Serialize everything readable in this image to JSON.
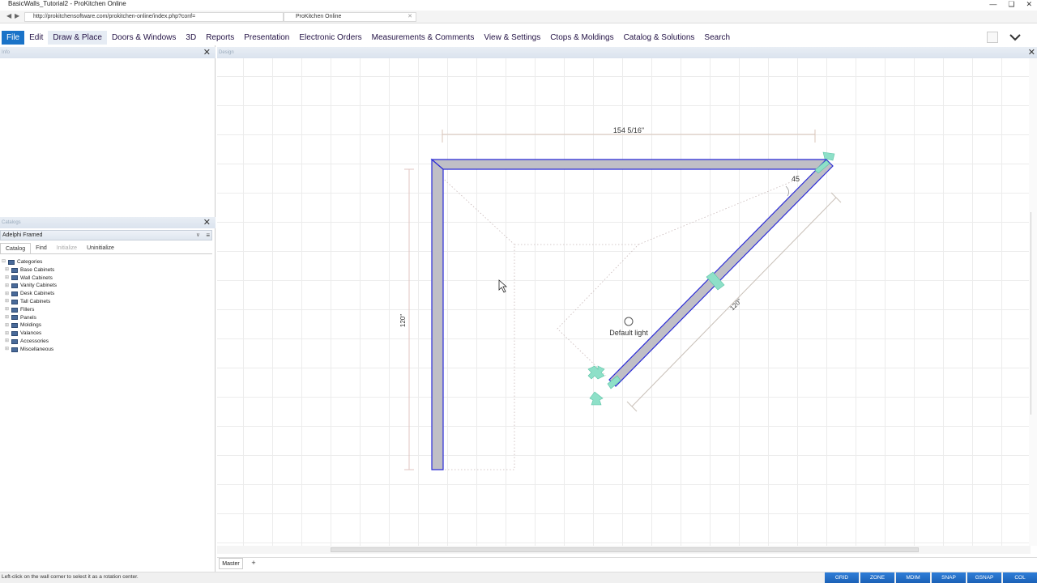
{
  "window": {
    "title": "BasicWalls_Tutorial2 - ProKitchen Online",
    "url": "http://prokitchensoftware.com/prokitchen-online/index.php?conf=",
    "tab_title": "ProKitchen Online"
  },
  "menu": {
    "items": [
      "File",
      "Edit",
      "Draw & Place",
      "Doors & Windows",
      "3D",
      "Reports",
      "Presentation",
      "Electronic Orders",
      "Measurements & Comments",
      "View & Settings",
      "Ctops & Moldings",
      "Catalog & Solutions",
      "Search"
    ],
    "active": "File",
    "highlighted": "Draw & Place"
  },
  "info_panel": {
    "title": "Info"
  },
  "catalog_panel": {
    "title": "Catalogs",
    "selected_catalog": "Adelphi Framed",
    "tabs": [
      "Catalog",
      "Find",
      "Initialize",
      "Uninitialize"
    ],
    "tree_root": "Categories",
    "categories": [
      "Base Cabinets",
      "Wall Cabinets",
      "Vanity Cabinets",
      "Desk Cabinets",
      "Tall Cabinets",
      "Fillers",
      "Panels",
      "Moldings",
      "Valances",
      "Accessories",
      "Miscellaneous"
    ]
  },
  "design": {
    "title": "Design",
    "dim_top": "154 5/16\"",
    "dim_left": "120\"",
    "dim_diag": "120\"",
    "angle": "45",
    "light_label": "Default light",
    "page_tab": "Master",
    "add_page": "+"
  },
  "status": {
    "text": "Left-click on the wall corner to select it as a rotation center.",
    "buttons": [
      "GRID",
      "ZONE",
      "MDIM",
      "SNAP",
      "GSNAP",
      "COL"
    ]
  },
  "colors": {
    "accent": "#1a73c8",
    "wall_fill": "#c0bfc6",
    "wall_border": "#2b2bd6",
    "handle": "#8ee0c8"
  }
}
